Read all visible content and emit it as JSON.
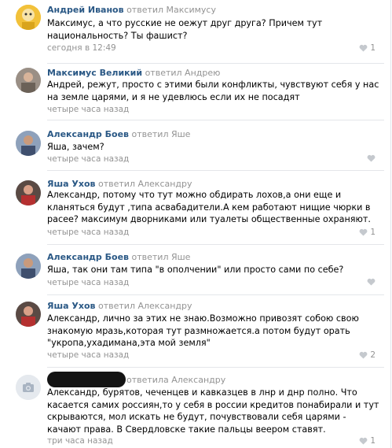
{
  "comments": [
    {
      "author": "Андрей Иванов",
      "reply_label": "ответил Максимусу",
      "text": "Максимус, а что русские не оежут друг друга? Причем тут национальность? Ты фашист?",
      "date": "сегодня в 12:49",
      "likes": "1",
      "avatar_color": "#f2c13a"
    },
    {
      "author": "Максимус Великий",
      "reply_label": "ответил Андрею",
      "text": "Андрей, режут, просто с этими были конфликты, чувствуют себя у нас на земле царями, и я не удевлюсь если их не посадят",
      "date": "четыре часа назад",
      "likes": "",
      "avatar_color": "#6b6157"
    },
    {
      "author": "Александр Боев",
      "reply_label": "ответил Яше",
      "text": "Яша, зачем?",
      "date": "четыре часа назад",
      "likes": "",
      "avatar_color": "#3f4f6e"
    },
    {
      "author": "Яша Ухов",
      "reply_label": "ответил Александру",
      "text": "Александр, потому что тут можно обдирать лохов,а они еще и кланяться будут ,типа асвабадители.А кем работают нищие чюрки в расее? максимум дворниками или туалеты общественные охраняют.",
      "date": "четыре часа назад",
      "likes": "1",
      "avatar_color": "#b53030"
    },
    {
      "author": "Александр Боев",
      "reply_label": "ответил Яше",
      "text": "Яша, так они там типа \"в ополчении\" или просто сами по себе?",
      "date": "четыре часа назад",
      "likes": "",
      "avatar_color": "#3f4f6e"
    },
    {
      "author": "Яша Ухов",
      "reply_label": "ответил Александру",
      "text": "Александр, лично за этих не знаю.Возможно привозят собою свою знакомую мразь,которая тут размножается.а потом будут орать \"укропа,ухадимана,эта мой земля\"",
      "date": "четыре часа назад",
      "likes": "2",
      "avatar_color": "#b53030"
    },
    {
      "author": "",
      "reply_label": "ответила Александру",
      "text": "Александр, бурятов, чеченцев и кавказцев в лнр и днр полно. Что касается самих россиян,то у себя в россии кредитов понабирали и тут скрываются, мол искать не будут, почувствовали себя царями - качают права. В Свердловске такие пальцы веером ставят.",
      "date": "три часа назад",
      "likes": "1",
      "avatar_color": "#e5e9ee"
    }
  ]
}
